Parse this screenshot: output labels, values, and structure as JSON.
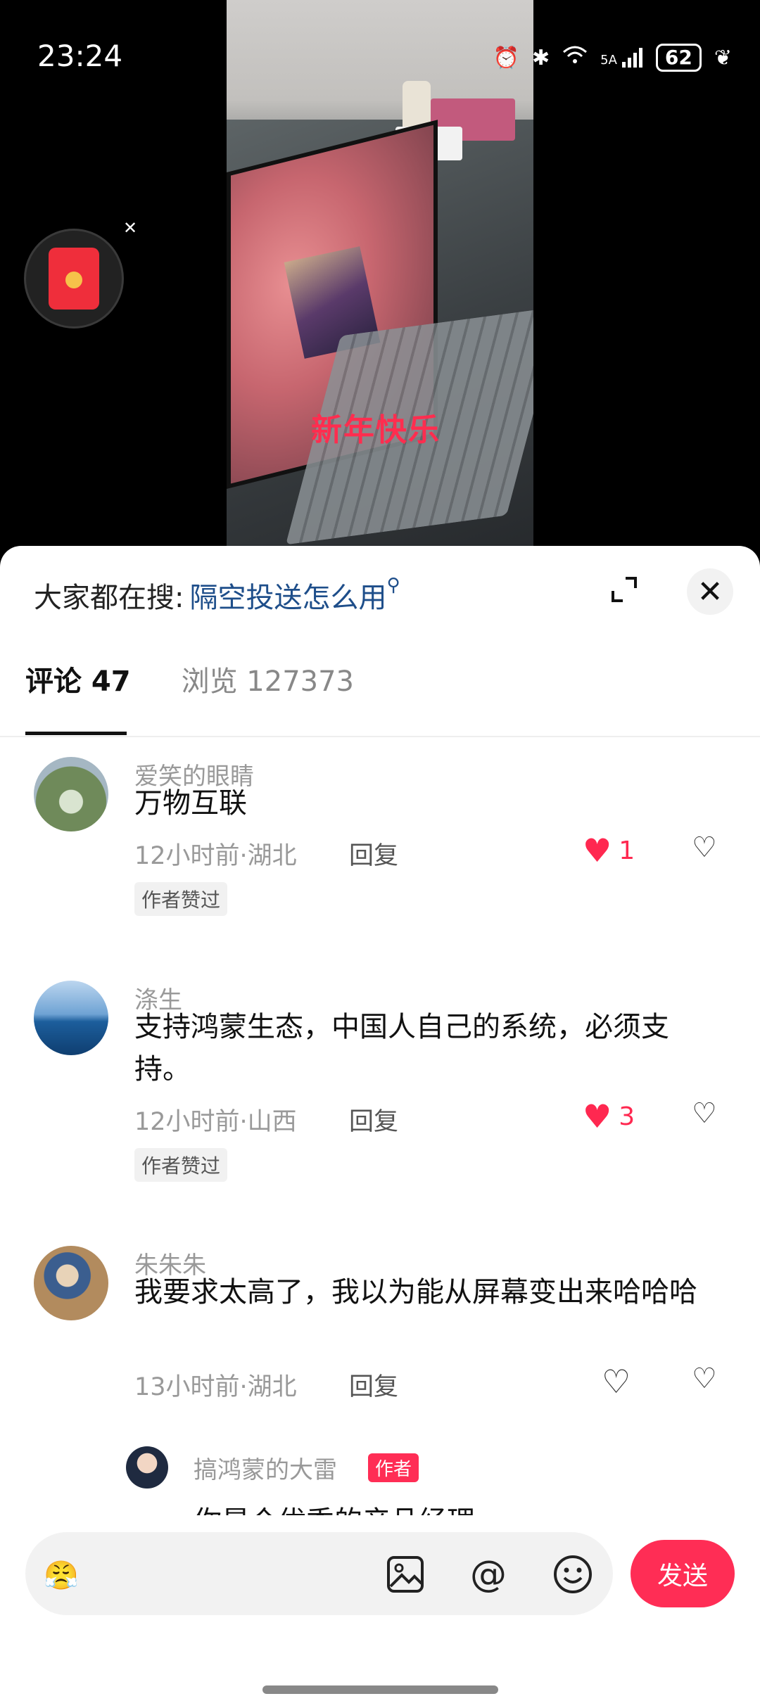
{
  "status_bar": {
    "time": "23:24",
    "signal": "5A",
    "battery": "62"
  },
  "video": {
    "overlay_text": "新年快乐"
  },
  "sheet": {
    "search_prefix": "大家都在搜:",
    "search_term": "隔空投送怎么用",
    "tabs": [
      {
        "label": "评论 47",
        "active": true
      },
      {
        "label": "浏览 127373",
        "active": false
      }
    ]
  },
  "comments": [
    {
      "name": "爱笑的眼睛",
      "text": "万物互联",
      "meta": "12小时前·湖北",
      "reply": "回复",
      "likes": "1",
      "liked": true,
      "tag": "作者赞过"
    },
    {
      "name": "涤生",
      "text": "支持鸿蒙生态，中国人自己的系统，必须支持。",
      "meta": "12小时前·山西",
      "reply": "回复",
      "likes": "3",
      "liked": true,
      "tag": "作者赞过"
    },
    {
      "name": "朱朱朱",
      "text": "我要求太高了，我以为能从屏幕变出来哈哈哈",
      "meta": "13小时前·湖北",
      "reply": "回复",
      "likes": "",
      "liked": false,
      "tag": ""
    }
  ],
  "sub_reply": {
    "name": "搞鸿蒙的大雷",
    "badge": "作者",
    "text": "你是个优秀的产品经理"
  },
  "input_bar": {
    "send_label": "发送"
  },
  "colors": {
    "accent": "#ff2d55",
    "link": "#1e4e8a"
  }
}
